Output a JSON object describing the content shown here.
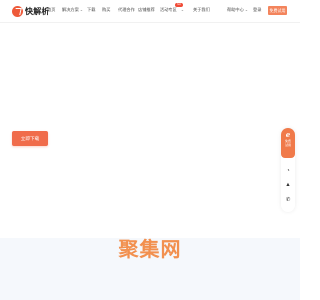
{
  "brand": {
    "name": "快解析"
  },
  "nav": {
    "items": [
      {
        "label": "首页"
      },
      {
        "label": "解决方案",
        "has_menu": true
      },
      {
        "label": "下载"
      },
      {
        "label": "购买"
      },
      {
        "label": "代理合作"
      },
      {
        "label": "店铺推荐"
      },
      {
        "label": "活动专区",
        "has_menu": true,
        "badge": "hot"
      },
      {
        "label": "关于我们"
      }
    ],
    "help": {
      "label": "帮助中心",
      "has_menu": true
    },
    "login": "登录",
    "trial": "免费试用"
  },
  "hero": {
    "cta": "立即下载"
  },
  "float_panel": {
    "top_line1": "免费",
    "top_line2": "试用",
    "icons": [
      "qq-icon",
      "chat-icon",
      "phone-icon"
    ]
  },
  "footer_brand": {
    "text": "聚集网"
  },
  "colors": {
    "accent": "#f06c4b",
    "brand_gradient": "#f2904f",
    "band": "#f5f8fc"
  }
}
